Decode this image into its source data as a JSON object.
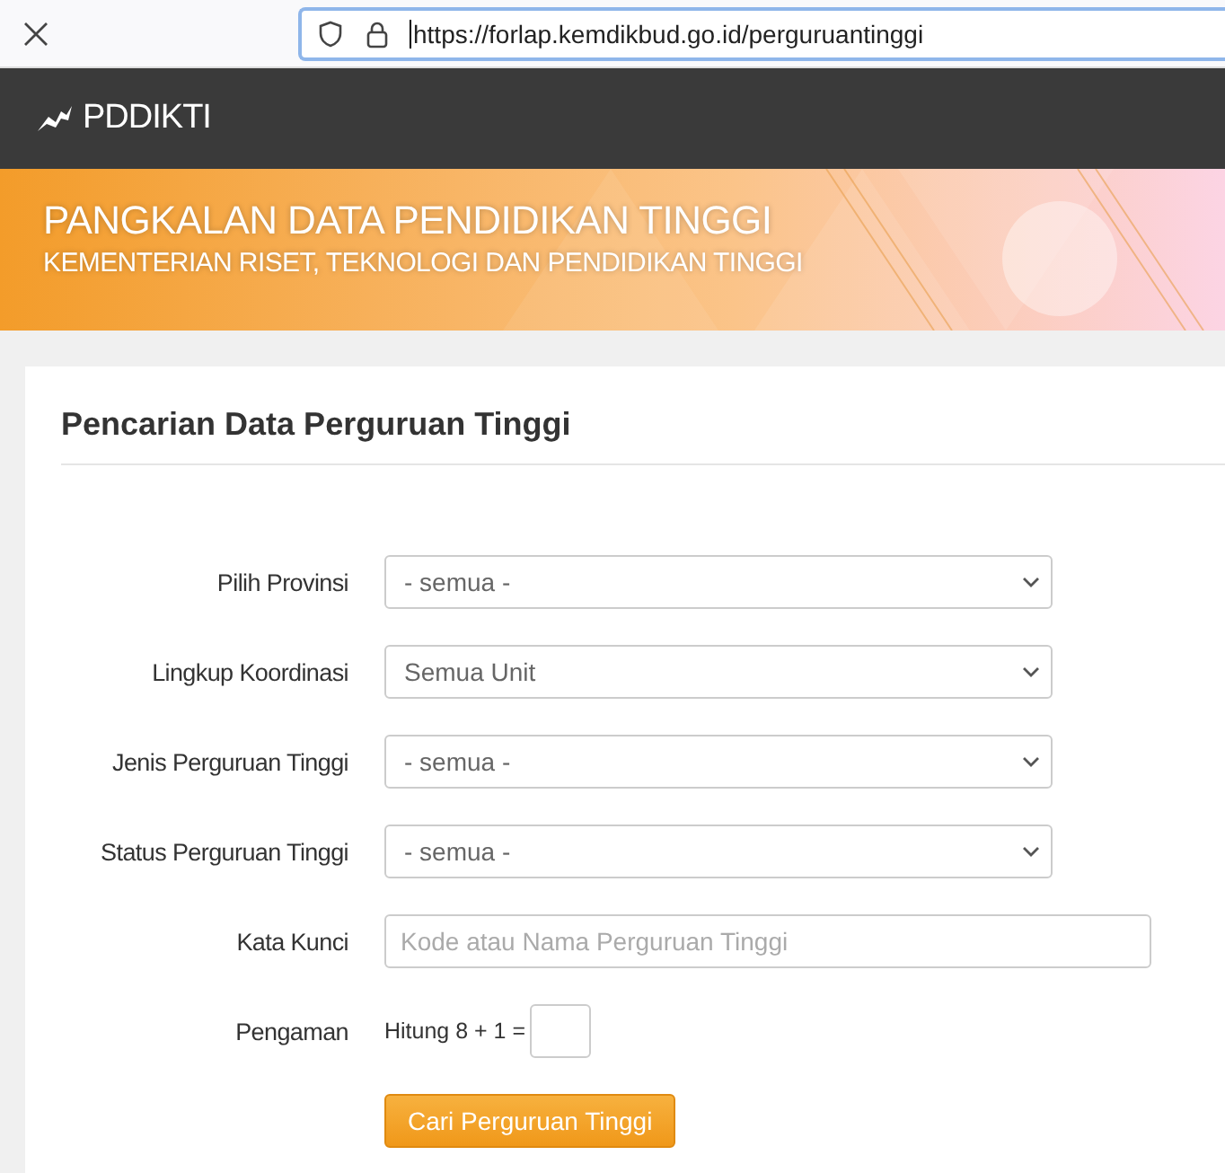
{
  "browser": {
    "url": "https://forlap.kemdikbud.go.id/perguruantinggi"
  },
  "navbar": {
    "brand": "PDDIKTI"
  },
  "banner": {
    "title": "PANGKALAN DATA PENDIDIKAN TINGGI",
    "subtitle": "KEMENTERIAN RISET, TEKNOLOGI DAN PENDIDIKAN TINGGI"
  },
  "form": {
    "title": "Pencarian Data Perguruan Tinggi",
    "fields": [
      {
        "kind": "select",
        "label": "Pilih Provinsi",
        "value": "- semua -"
      },
      {
        "kind": "select",
        "label": "Lingkup Koordinasi",
        "value": "Semua Unit"
      },
      {
        "kind": "select",
        "label": "Jenis Perguruan Tinggi",
        "value": "- semua -"
      },
      {
        "kind": "select",
        "label": "Status Perguruan Tinggi",
        "value": "- semua -"
      },
      {
        "kind": "text",
        "label": "Kata Kunci",
        "placeholder": "Kode atau Nama Perguruan Tinggi"
      },
      {
        "kind": "captcha",
        "label": "Pengaman",
        "question": "Hitung 8 + 1 ="
      }
    ],
    "submit": "Cari Perguruan Tinggi"
  }
}
